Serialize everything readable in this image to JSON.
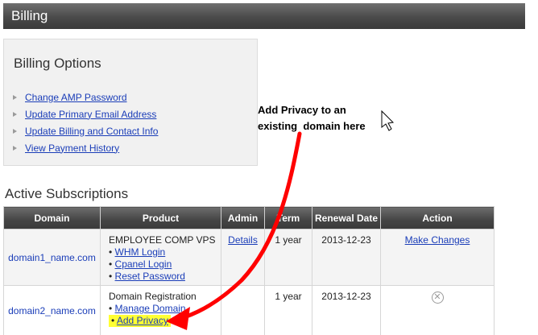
{
  "header": {
    "title": "Billing"
  },
  "billing_options": {
    "title": "Billing Options",
    "links": [
      "Change AMP Password",
      "Update Primary Email Address",
      "Update Billing and Contact Info",
      "View Payment History"
    ]
  },
  "annotation": {
    "text": "Add Privacy to an\nexisting  domain here"
  },
  "subscriptions": {
    "title": "Active Subscriptions",
    "columns": [
      "Domain",
      "Product",
      "Admin",
      "Term",
      "Renewal Date",
      "Action"
    ],
    "rows": [
      {
        "domain": "domain1_name.com",
        "product": "EMPLOYEE COMP VPS",
        "product_links": [
          "WHM Login",
          "Cpanel Login",
          "Reset Password"
        ],
        "admin": "Details",
        "term": "1 year",
        "renewal": "2013-12-23",
        "action": "Make Changes"
      },
      {
        "domain": "domain2_name.com",
        "product": "Domain Registration",
        "product_links": [
          "Manage Domain",
          "Add Privacy"
        ],
        "admin": "",
        "term": "1 year",
        "renewal": "2013-12-23",
        "action_icon": "cancel-circle-icon"
      }
    ]
  },
  "colors": {
    "arrow": "#ff0000",
    "highlight": "#ffff33",
    "link": "#1a3db8"
  }
}
